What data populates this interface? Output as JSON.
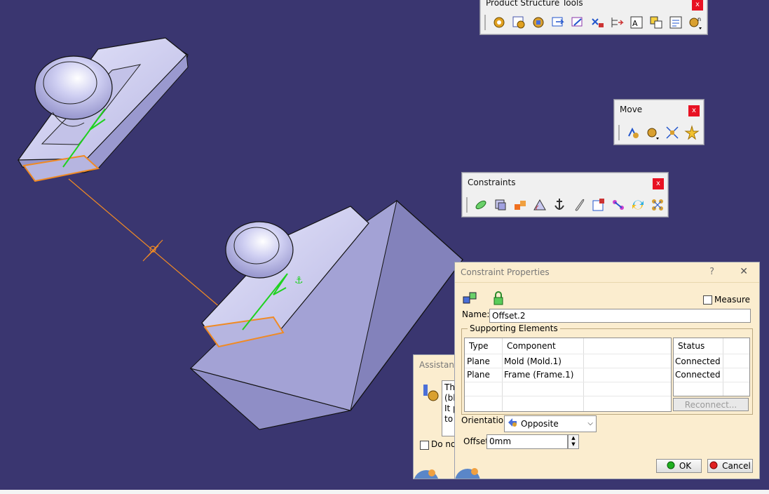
{
  "toolbars": {
    "product_structure": {
      "title": "Product Structure Tools",
      "close": "x"
    },
    "move": {
      "title": "Move",
      "close": "x"
    },
    "constraints": {
      "title": "Constraints",
      "close": "x"
    }
  },
  "assistant": {
    "title": "Assistant",
    "text_lines": [
      "Th",
      "(bl",
      "It p",
      "to"
    ],
    "checkbox_label": "Do no"
  },
  "constraint_dialog": {
    "title": "Constraint Properties",
    "help": "?",
    "close": "✕",
    "measure_label": "Measure",
    "name_label": "Name:",
    "name_value": "Offset.2",
    "group_label": "Supporting Elements",
    "columns": {
      "type": "Type",
      "component": "Component",
      "status": "Status"
    },
    "rows": [
      {
        "type": "Plane",
        "component": "Mold (Mold.1)",
        "status": "Connected"
      },
      {
        "type": "Plane",
        "component": "Frame (Frame.1)",
        "status": "Connected"
      }
    ],
    "reconnect_label": "Reconnect...",
    "orientation_label": "Orientation",
    "orientation_value": "Opposite",
    "offset_label": "Offset",
    "offset_value": "0mm",
    "ok_label": "OK",
    "cancel_label": "Cancel"
  },
  "colors": {
    "background": "#3a3670",
    "part_face": "#c9c8ea",
    "dialog_bg": "#fbedcf",
    "highlight_orange": "#f08a24",
    "constraint_green": "#1fd21f"
  }
}
